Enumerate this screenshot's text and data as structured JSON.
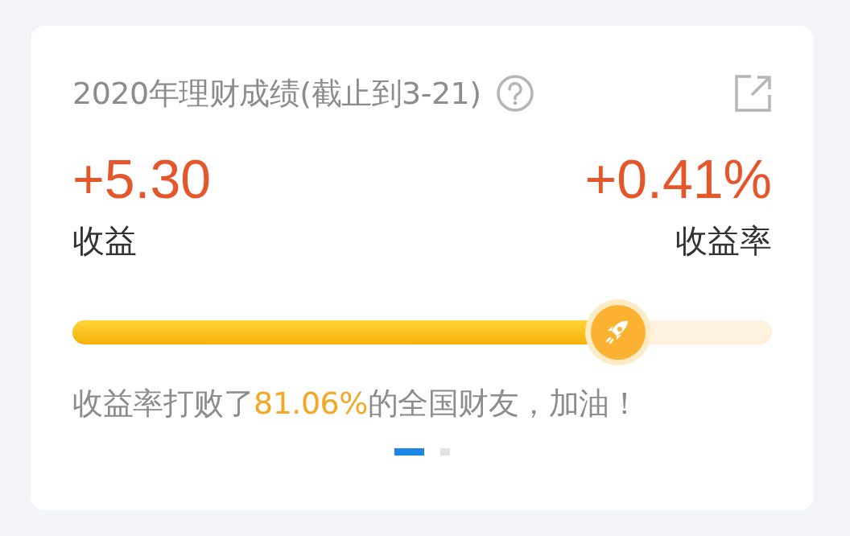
{
  "card": {
    "title": "2020年理财成绩(截止到3-21)",
    "metrics": [
      {
        "value": "+5.30",
        "label": "收益"
      },
      {
        "value": "+0.41%",
        "label": "收益率"
      }
    ],
    "progress": {
      "level": 0.78
    },
    "summary": {
      "before": "收益率打败了",
      "highlight": "81.06%",
      "after": "的全国财友，加油！"
    },
    "pages": [
      {
        "selected": true
      },
      {
        "selected": false
      }
    ]
  }
}
